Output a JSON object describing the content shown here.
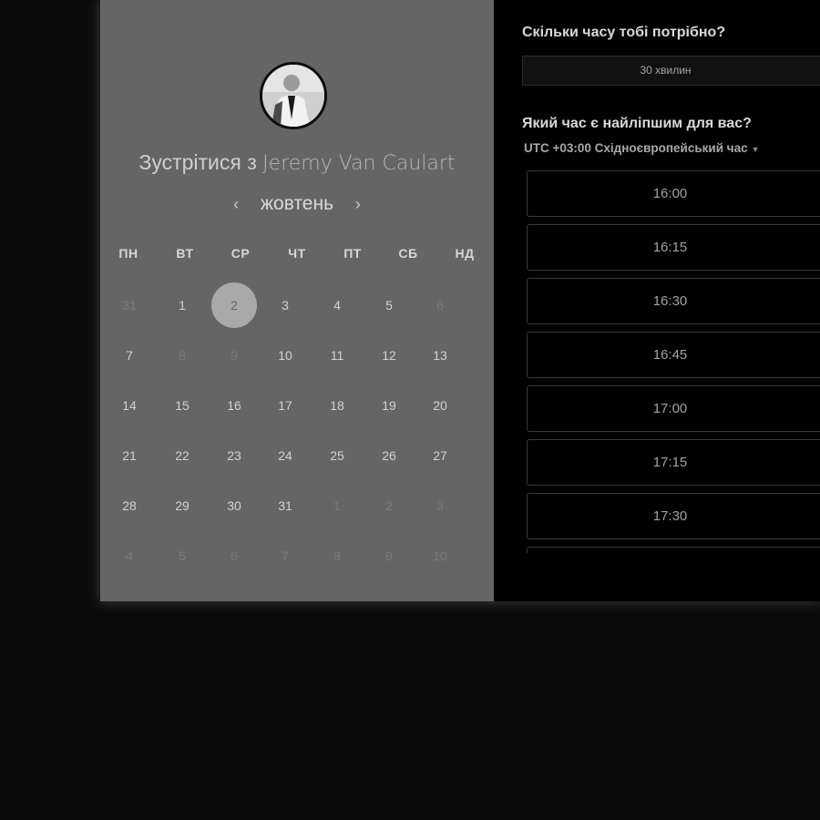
{
  "host": {
    "title_prefix": "Зустрітися з",
    "name": "Jeremy Van Caulart"
  },
  "calendar": {
    "month": "жовтень",
    "prev_icon": "chevron-left-icon",
    "next_icon": "chevron-right-icon",
    "weekdays": [
      "ПН",
      "ВТ",
      "СР",
      "ЧТ",
      "ПТ",
      "СБ",
      "НД"
    ],
    "weeks": [
      [
        "31",
        "1",
        "2",
        "3",
        "4",
        "5",
        "6"
      ],
      [
        "7",
        "8",
        "9",
        "10",
        "11",
        "12",
        "13"
      ],
      [
        "14",
        "15",
        "16",
        "17",
        "18",
        "19",
        "20"
      ],
      [
        "21",
        "22",
        "23",
        "24",
        "25",
        "26",
        "27"
      ],
      [
        "28",
        "29",
        "30",
        "31",
        "1",
        "2",
        "3"
      ],
      [
        "4",
        "5",
        "6",
        "7",
        "8",
        "9",
        "10"
      ]
    ],
    "muted_cells": [
      [
        0,
        0
      ],
      [
        0,
        6
      ],
      [
        1,
        1
      ],
      [
        1,
        2
      ],
      [
        4,
        4
      ],
      [
        4,
        5
      ],
      [
        4,
        6
      ],
      [
        5,
        0
      ],
      [
        5,
        1
      ],
      [
        5,
        2
      ],
      [
        5,
        3
      ],
      [
        5,
        4
      ],
      [
        5,
        5
      ],
      [
        5,
        6
      ]
    ],
    "selected_cell": [
      0,
      2
    ]
  },
  "duration": {
    "question": "Скільки часу тобі потрібно?",
    "selected": "30 хвилин"
  },
  "time": {
    "question": "Який час є найліпшим для вас?",
    "timezone": "UTC +03:00 Східноєвропейський час",
    "slots": [
      "16:00",
      "16:15",
      "16:30",
      "16:45",
      "17:00",
      "17:15",
      "17:30",
      ""
    ]
  },
  "colors": {
    "calendar_bg": "#656565",
    "page_bg": "#0b0b0b",
    "selected_day_bg": "#a9a9a9"
  }
}
